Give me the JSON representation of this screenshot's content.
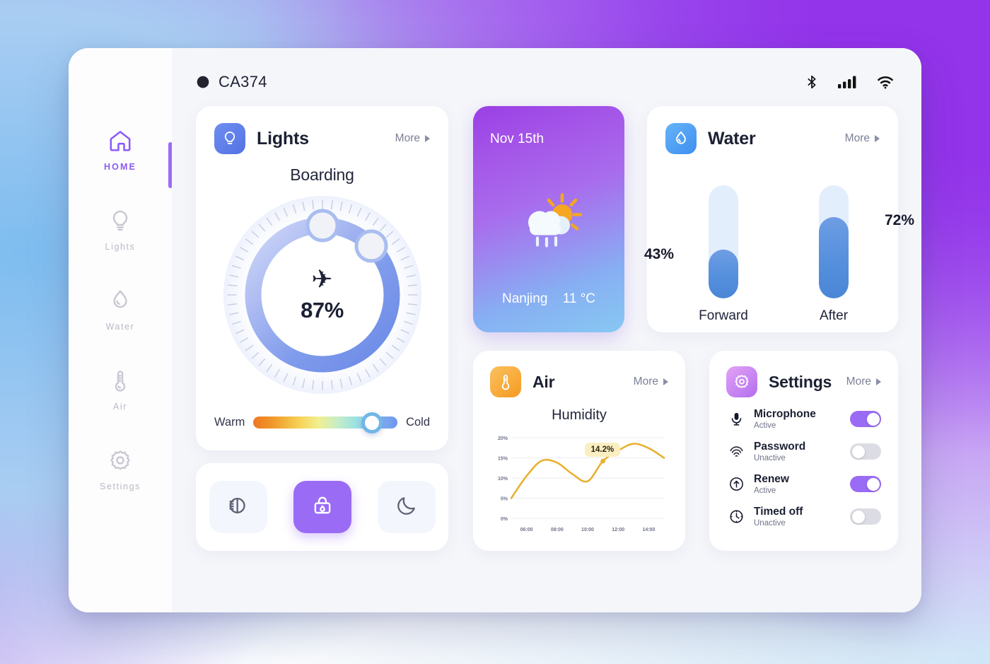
{
  "header": {
    "logo_icon": "eclipse-logo-icon",
    "title": "CA374",
    "status": [
      "bluetooth-icon",
      "cellular-signal-icon",
      "wifi-icon"
    ]
  },
  "sidebar": {
    "items": [
      {
        "label": "HOME",
        "icon": "home-icon",
        "active": true
      },
      {
        "label": "Lights",
        "icon": "bulb-icon",
        "active": false
      },
      {
        "label": "Water",
        "icon": "droplet-icon",
        "active": false
      },
      {
        "label": "Air",
        "icon": "thermometer-icon",
        "active": false
      },
      {
        "label": "Settings",
        "icon": "gear-icon",
        "active": false
      }
    ]
  },
  "lights": {
    "title": "Lights",
    "icon": "bulb-icon",
    "more_label": "More",
    "mode": "Boarding",
    "center_icon": "airplane-icon",
    "percent": "87%",
    "percent_value": 87,
    "handles": [
      {
        "angle_deg": 0
      },
      {
        "angle_deg": 45
      }
    ],
    "slider": {
      "warm_label": "Warm",
      "cold_label": "Cold",
      "value": 82.5
    }
  },
  "quick_actions": [
    {
      "icon": "headlight-icon",
      "active": false
    },
    {
      "icon": "lock-drop-icon",
      "active": true
    },
    {
      "icon": "moon-icon",
      "active": false
    }
  ],
  "weather": {
    "date": "Nov 15th",
    "icon": "sun-cloud-rain-icon",
    "city": "Nanjing",
    "temperature": "11 °C"
  },
  "water": {
    "title": "Water",
    "icon": "droplet-icon",
    "more_label": "More",
    "columns": [
      {
        "label": "Forward",
        "percent": "43%",
        "value": 43
      },
      {
        "label": "After",
        "percent": "72%",
        "value": 72
      }
    ]
  },
  "air": {
    "title": "Air",
    "icon": "thermometer-icon",
    "more_label": "More",
    "subtitle": "Humidity",
    "tooltip": "14.2%"
  },
  "chart_data": {
    "type": "line",
    "title": "Humidity",
    "xlabel": "",
    "ylabel": "",
    "x": [
      "05:00",
      "06:00",
      "07:15",
      "08:00",
      "09:00",
      "10:00",
      "11:15",
      "12:00",
      "13:00",
      "14:00",
      "14:30"
    ],
    "values": [
      5.0,
      10.5,
      14.3,
      13.8,
      11.0,
      9.2,
      14.2,
      16.8,
      18.5,
      17.4,
      15.0
    ],
    "series": [
      {
        "name": "Humidity",
        "values": [
          5.0,
          10.5,
          14.3,
          13.8,
          11.0,
          9.2,
          14.2,
          16.8,
          18.5,
          17.4,
          15.0
        ],
        "color": "#e8b130"
      }
    ],
    "xticks": [
      "06:00",
      "08:00",
      "10:00",
      "12:00",
      "14:00"
    ],
    "yticks": [
      "0%",
      "5%",
      "10%",
      "15%",
      "20%"
    ],
    "ylim": [
      0,
      20
    ],
    "grid": true,
    "legend": "none",
    "annotations": [
      {
        "label": "14.2%",
        "x": "11:15",
        "y": 14.2
      }
    ]
  },
  "settings": {
    "title": "Settings",
    "icon": "gear-icon",
    "more_label": "More",
    "rows": [
      {
        "name": "Microphone",
        "state": "Active",
        "icon": "microphone-icon",
        "on": true
      },
      {
        "name": "Password",
        "state": "Unactive",
        "icon": "fingerprint-icon",
        "on": false
      },
      {
        "name": "Renew",
        "state": "Active",
        "icon": "arrow-up-circle-icon",
        "on": true
      },
      {
        "name": "Timed off",
        "state": "Unactive",
        "icon": "clock-icon",
        "on": false
      }
    ]
  },
  "colors": {
    "accent_purple": "#9a6bf5",
    "accent_blue": "#6d8fe8",
    "water_blue": "#5590dd",
    "air_orange": "#f5a623",
    "chart_yellow": "#e8b130"
  }
}
